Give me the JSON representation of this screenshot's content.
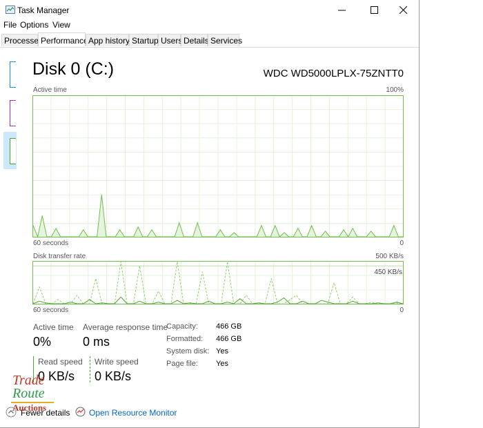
{
  "window": {
    "title": "Task Manager",
    "app_icon": "task-manager-icon"
  },
  "window_controls": {
    "minimize_icon": "minimize-icon",
    "maximize_icon": "maximize-icon",
    "close_icon": "close-icon"
  },
  "menu": {
    "file": "File",
    "options": "Options",
    "view": "View"
  },
  "tabs": [
    "Processes",
    "Performance",
    "App history",
    "Startup",
    "Users",
    "Details",
    "Services"
  ],
  "active_tab": "Performance",
  "disk": {
    "title": "Disk 0 (C:)",
    "model": "WDC WD5000LPLX-75ZNTT0"
  },
  "active_time_chart": {
    "label": "Active time",
    "max_label": "100%",
    "left_label": "60 seconds",
    "right_label": "0"
  },
  "transfer_chart": {
    "label": "Disk transfer rate",
    "max_label": "500 KB/s",
    "line_label": "450 KB/s",
    "left_label": "60 seconds",
    "right_label": "0"
  },
  "stats": {
    "active_time_label": "Active time",
    "active_time_value": "0%",
    "response_label": "Average response time",
    "response_value": "0 ms",
    "read_label": "Read speed",
    "read_value": "0 KB/s",
    "write_label": "Write speed",
    "write_value": "0 KB/s"
  },
  "properties": {
    "capacity_label": "Capacity:",
    "capacity_value": "466 GB",
    "formatted_label": "Formatted:",
    "formatted_value": "466 GB",
    "system_label": "System disk:",
    "system_value": "Yes",
    "pagefile_label": "Page file:",
    "pagefile_value": "Yes"
  },
  "footer": {
    "fewer_details": "Fewer details",
    "resource_monitor": "Open Resource Monitor"
  },
  "watermark": {
    "line1": "Trade",
    "line2": "Route",
    "line3": "Auctions"
  },
  "colors": {
    "accent_green": "#6fbf4a",
    "fill_green": "#e6f4df",
    "grid": "#e5f2dc",
    "link": "#0066cc"
  },
  "chart_data": [
    {
      "type": "area",
      "title": "Active time",
      "ylim": [
        0,
        100
      ],
      "x": [
        60,
        58,
        57,
        56,
        55,
        53,
        52,
        51,
        50,
        49,
        47,
        46,
        45,
        44,
        43,
        42,
        40,
        39,
        37,
        36,
        35,
        34,
        33,
        32,
        31,
        30,
        29,
        28,
        27,
        26,
        25,
        24,
        23,
        22,
        21,
        20,
        19,
        18,
        17,
        16,
        15,
        14,
        13,
        12,
        11,
        10,
        9,
        8,
        7,
        6,
        5,
        4,
        3,
        2,
        1,
        0
      ],
      "values": [
        8,
        0,
        15,
        0,
        0,
        6,
        0,
        0,
        0,
        0,
        0,
        5,
        0,
        0,
        0,
        30,
        0,
        0,
        0,
        5,
        0,
        0,
        0,
        7,
        0,
        0,
        5,
        0,
        0,
        0,
        0,
        0,
        10,
        0,
        0,
        0,
        10,
        0,
        0,
        0,
        0,
        5,
        0,
        0,
        3,
        0,
        0,
        0,
        0,
        0,
        8,
        0,
        0,
        8,
        0,
        3,
        0,
        0,
        6,
        0,
        0,
        8,
        0,
        0,
        4,
        0,
        0,
        0,
        5,
        0,
        6,
        0,
        0,
        0,
        4,
        0,
        0,
        0,
        0,
        8,
        0,
        0
      ]
    },
    {
      "type": "line",
      "title": "Disk transfer rate",
      "ylim": [
        0,
        500
      ],
      "series": [
        {
          "values": [
            0,
            200,
            0,
            0,
            50,
            0,
            0,
            100,
            0,
            0,
            300,
            0,
            0,
            0,
            500,
            0,
            0,
            450,
            0,
            0,
            150,
            0,
            0,
            500,
            0,
            0,
            0,
            380,
            0,
            0,
            0,
            500,
            0,
            0,
            100,
            0,
            0,
            0,
            300,
            0,
            0,
            50,
            100,
            0,
            0,
            0,
            0,
            0,
            250,
            0,
            0,
            80,
            0,
            0,
            20,
            0,
            0,
            0,
            10,
            0
          ]
        },
        {
          "values": [
            0,
            30,
            10,
            0,
            0,
            0,
            20,
            0,
            0,
            50,
            0,
            10,
            0,
            0,
            80,
            0,
            0,
            30,
            0,
            0,
            20,
            0,
            0,
            40,
            0,
            10,
            0,
            0,
            30,
            0,
            0,
            20,
            0,
            60,
            0,
            0,
            10,
            0,
            0,
            20,
            70,
            0,
            0,
            30,
            0,
            0,
            40,
            20,
            0,
            0,
            0,
            30,
            0,
            0,
            0,
            10,
            0,
            0,
            20,
            0
          ]
        }
      ]
    }
  ]
}
